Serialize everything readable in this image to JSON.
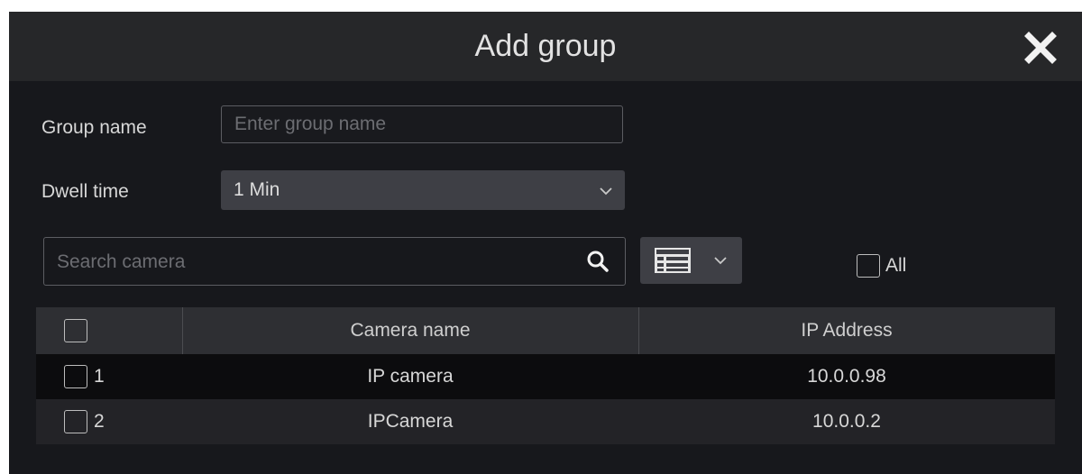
{
  "dialog": {
    "title": "Add group",
    "close_icon": "close-icon"
  },
  "form": {
    "group_name_label": "Group name",
    "group_name_placeholder": "Enter group name",
    "group_name_value": "",
    "dwell_time_label": "Dwell time",
    "dwell_time_value": "1 Min"
  },
  "search": {
    "placeholder": "Search camera",
    "icon": "search-icon"
  },
  "view_mode": {
    "icon": "list-view-icon"
  },
  "select_all": {
    "label": "All",
    "checked": false
  },
  "table": {
    "columns": [
      "",
      "Camera name",
      "IP Address"
    ],
    "rows": [
      {
        "index": "1",
        "camera_name": "IP camera",
        "ip_address": "10.0.0.98",
        "checked": false
      },
      {
        "index": "2",
        "camera_name": "IPCamera",
        "ip_address": "10.0.0.2",
        "checked": false
      }
    ]
  },
  "colors": {
    "dialog_bg": "#17181c",
    "titlebar_bg": "#262729",
    "header_bg": "#2e2f33",
    "dropdown_bg": "#3e3f45",
    "text": "#d7d7d7",
    "placeholder": "#6c6d72"
  }
}
